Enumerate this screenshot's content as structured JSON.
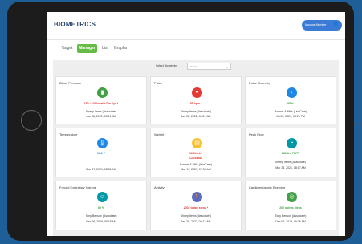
{
  "app": {
    "title": "BIOMETRICS",
    "manage_label": "Manage Member"
  },
  "tabs": [
    {
      "label": "Target",
      "active": false
    },
    {
      "label": "Manager",
      "active": true
    },
    {
      "label": "List",
      "active": false
    },
    {
      "label": "Graphs",
      "active": false
    }
  ],
  "filter": {
    "label": "Select Biometrics",
    "value": "Select"
  },
  "cards": [
    {
      "title": "Blood Pressure",
      "icon": "heart-meter-icon",
      "color": "#43a047",
      "value": "180 / 105 Invalid Dia Sys *",
      "by": "Sheep Items (Associate)",
      "date": "Jan 28, 2022, 08:21 AM"
    },
    {
      "title": "Pulse",
      "icon": "pulse-icon",
      "color": "#e53935",
      "value": "85 bpm *",
      "by": "Sheep Items (Associate)",
      "date": "Jan 28, 2022, 08:21 AM"
    },
    {
      "title": "Pulse Oximetry",
      "icon": "oximeter-icon",
      "color": "#1e88e5",
      "value": "98 %",
      "by": "Bonner & Mills (LiveCare)",
      "date": "Jul 26, 2021, 03:21 PM"
    },
    {
      "title": "Temperature",
      "icon": "thermometer-icon",
      "color": "#1e88e5",
      "value": "98.2 F",
      "by": "",
      "date": "Mar 17, 2021, 08:51 AM"
    },
    {
      "title": "Weight",
      "icon": "scale-icon",
      "color": "#fbc02d",
      "value": "96.24 Lb *",
      "value2": "13.28 BMI",
      "by": "Bonner & Mills (LiveCare)",
      "date": "Mar 17, 2021, 07:30 AM"
    },
    {
      "title": "Peak Flow",
      "icon": "peak-flow-icon",
      "color": "#0097a7",
      "value": "283 l/m PEFR",
      "by": "Sheep Items (Associate)",
      "date": "Mar 23, 2021, 08:07 AM"
    },
    {
      "title": "Forced Expiratory Volume",
      "icon": "lungs-icon",
      "color": "#0097a7",
      "value": "80 %",
      "by": "Tony Benson (Associate)",
      "date": "Dec 06, 2019, 09:15 AM"
    },
    {
      "title": "Activity",
      "icon": "walking-icon",
      "color": "#5c6bc0",
      "value": "2004 today steps *",
      "by": "Sheep Items (Associate)",
      "date": "Jan 28, 2022, 09:17 AM"
    },
    {
      "title": "Cardiometabolic Exercise",
      "icon": "exercise-icon",
      "color": "#43a047",
      "value": "200 points steps",
      "by": "Tony Benson (Associate)",
      "date": "Dec 06, 2019, 09:38 AM"
    }
  ]
}
